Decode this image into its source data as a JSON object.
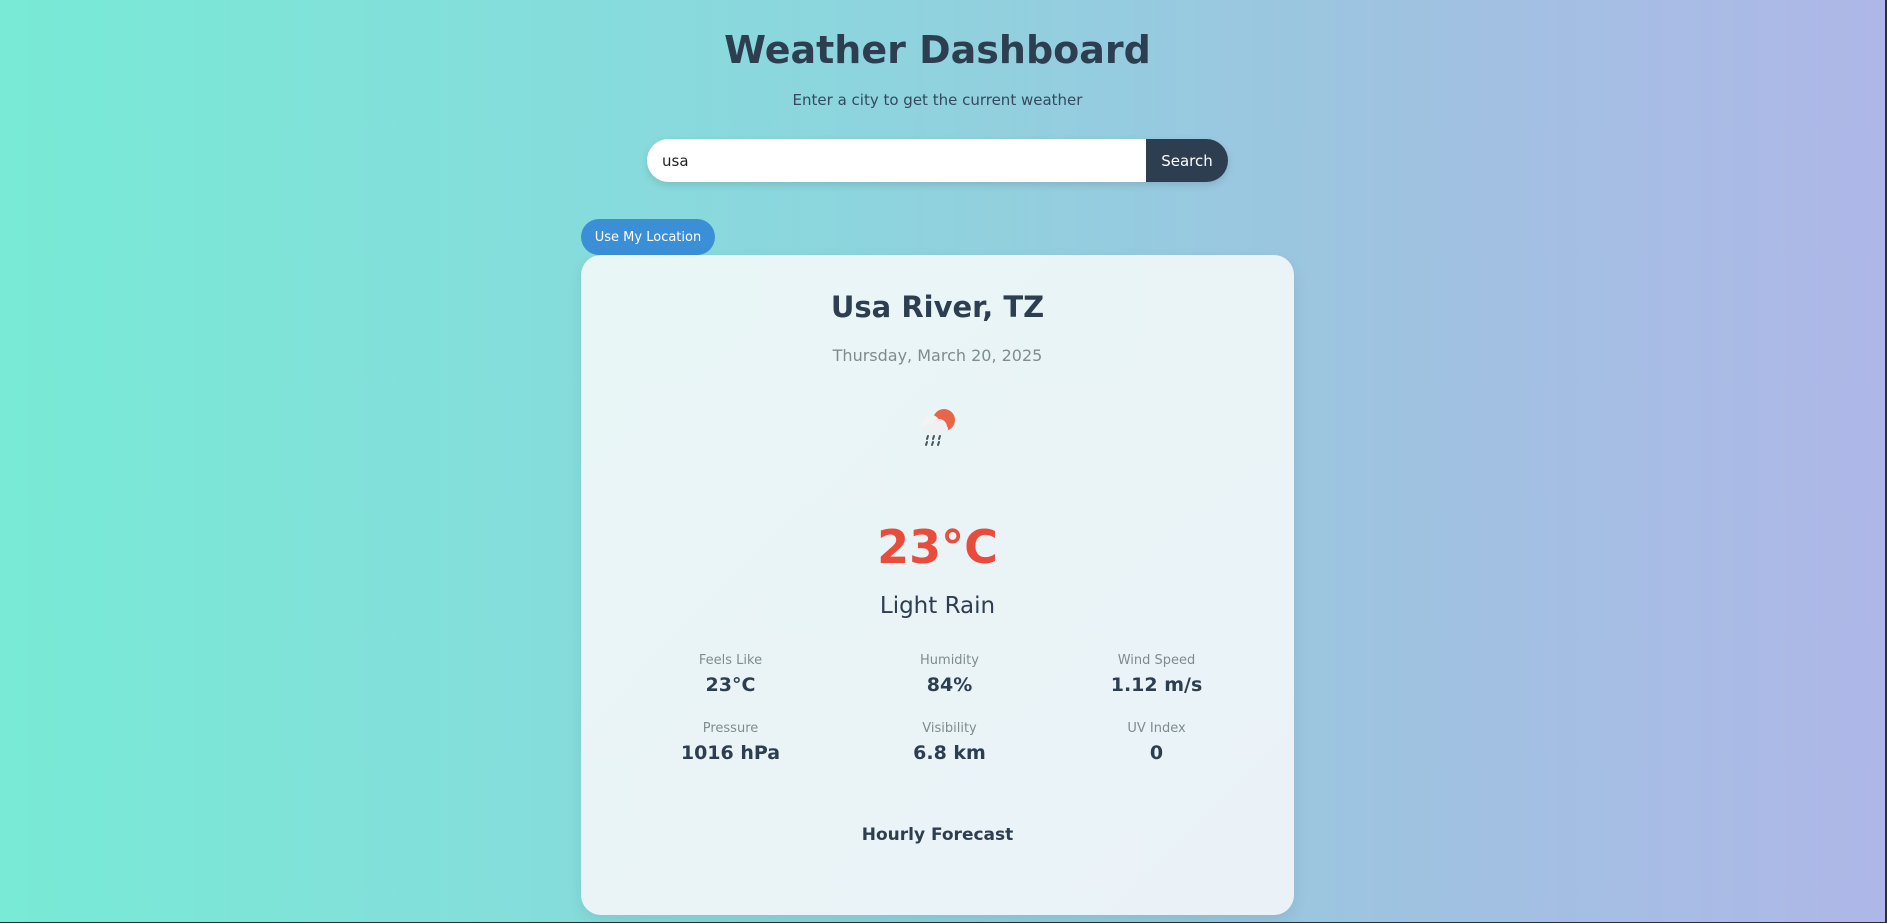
{
  "header": {
    "title": "Weather Dashboard",
    "subtitle": "Enter a city to get the current weather"
  },
  "search": {
    "value": "usa",
    "button_label": "Search"
  },
  "location_button_label": "Use My Location",
  "weather": {
    "city": "Usa River, TZ",
    "date": "Thursday, March 20, 2025",
    "icon": "light-rain-icon",
    "temperature": "23°C",
    "condition": "Light Rain",
    "details": [
      {
        "label": "Feels Like",
        "value": "23°C"
      },
      {
        "label": "Humidity",
        "value": "84%"
      },
      {
        "label": "Wind Speed",
        "value": "1.12 m/s"
      },
      {
        "label": "Pressure",
        "value": "1016 hPa"
      },
      {
        "label": "Visibility",
        "value": "6.8 km"
      },
      {
        "label": "UV Index",
        "value": "0"
      }
    ],
    "forecast_heading": "Hourly Forecast"
  },
  "colors": {
    "accent_dark": "#2c3e50",
    "location_button": "#3a8fd6",
    "temperature": "#e74c3c",
    "sun": "#e8654a"
  }
}
